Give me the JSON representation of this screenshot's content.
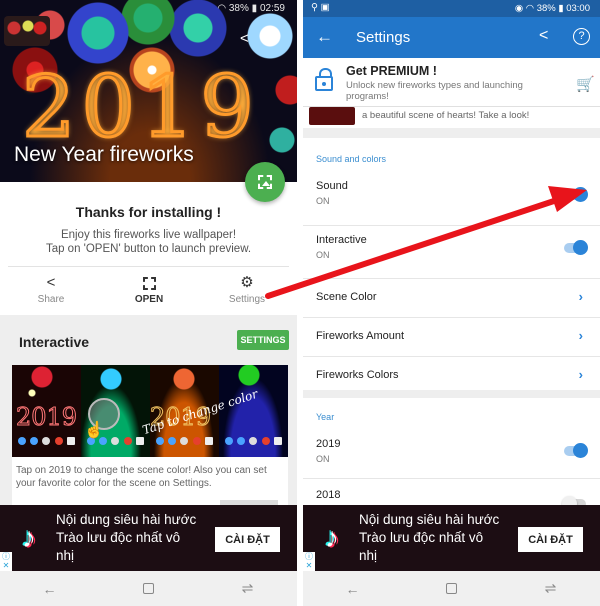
{
  "left_screen": {
    "status_bar": {
      "battery": "38%",
      "time": "02:59"
    },
    "hero": {
      "title": "New Year fireworks",
      "year_art": "2019"
    },
    "install_card": {
      "title": "Thanks for installing !",
      "subtitle_line1": "Enjoy this fireworks live wallpaper!",
      "subtitle_line2": "Tap on 'OPEN' button to launch preview."
    },
    "actions": [
      {
        "label": "Share",
        "icon": "share-icon"
      },
      {
        "label": "OPEN",
        "icon": "wallpaper-icon"
      },
      {
        "label": "Settings",
        "icon": "gear-icon"
      }
    ],
    "interactive_section": {
      "title": "Interactive",
      "settings_button": "SETTINGS",
      "preview_overlay_text": "Tap to change color",
      "preview_year": "2019",
      "description": "Tap on 2019 to change the scene color! Also you can set your favorite color for the scene on Settings."
    }
  },
  "right_screen": {
    "status_bar": {
      "battery": "38%",
      "time": "03:00"
    },
    "app_bar": {
      "title": "Settings",
      "back_icon": "arrow-back-icon",
      "share_icon": "share-icon",
      "help_icon": "help-icon"
    },
    "premium": {
      "title": "Get PREMIUM !",
      "subtitle": "Unlock new fireworks types and launching programs!",
      "icon": "lock-icon",
      "cart_icon": "cart-icon"
    },
    "hearts_promo": {
      "text": "a beautiful scene of hearts! Take a look!"
    },
    "sound_and_colors": {
      "header": "Sound and colors",
      "items": [
        {
          "title": "Sound",
          "summary": "ON",
          "type": "switch",
          "checked": true
        },
        {
          "title": "Interactive",
          "summary": "ON",
          "type": "switch",
          "checked": true
        },
        {
          "title": "Scene Color",
          "type": "link"
        },
        {
          "title": "Fireworks Amount",
          "type": "link"
        },
        {
          "title": "Fireworks Colors",
          "type": "link"
        }
      ]
    },
    "year": {
      "header": "Year",
      "items": [
        {
          "title": "2019",
          "summary": "ON",
          "type": "switch",
          "checked": true
        },
        {
          "title": "2018",
          "type": "switch",
          "checked": false
        }
      ]
    }
  },
  "ad": {
    "text": "Nội dung siêu hài hước Trào lưu độc nhất vô nhị",
    "button": "CÀI ĐẶT",
    "logo": "tiktok-logo",
    "adchoices": "ⓘ✕"
  },
  "nav_bar": {
    "back": "←",
    "home": "",
    "recents": "⇌"
  },
  "annotation": {
    "type": "red-arrow",
    "from": "Settings action",
    "to": "Sound switch",
    "color": "#e8141b"
  }
}
